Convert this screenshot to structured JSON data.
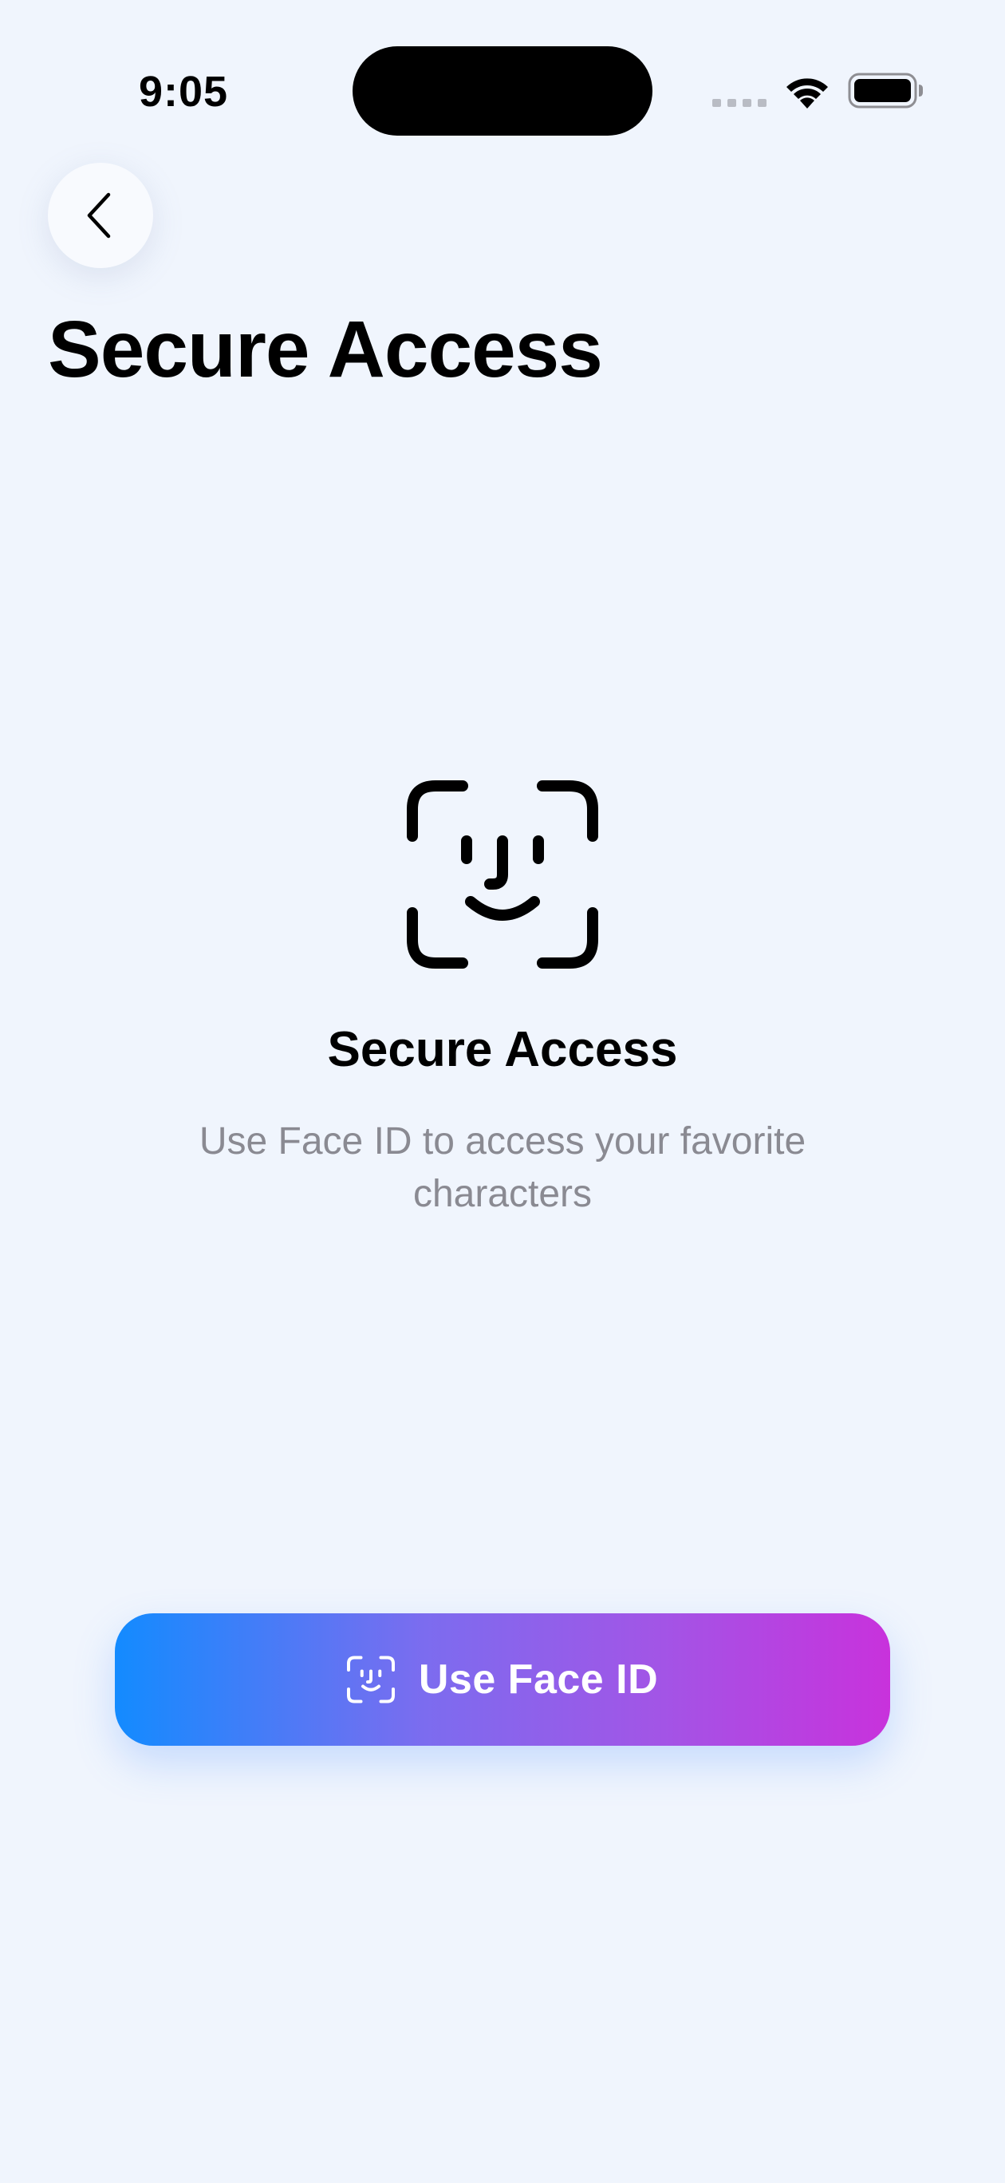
{
  "status_bar": {
    "time": "9:05",
    "icons": [
      "cellular-signal-icon",
      "wifi-icon",
      "battery-icon"
    ]
  },
  "nav": {
    "back_icon": "chevron-left-icon"
  },
  "header": {
    "title": "Secure Access"
  },
  "main": {
    "hero_icon": "face-id-icon",
    "heading": "Secure Access",
    "description": "Use Face ID to access your favorite characters"
  },
  "action": {
    "button_label": "Use Face ID",
    "button_icon": "face-id-icon",
    "gradient_start": "#138BFF",
    "gradient_end": "#C832DC"
  },
  "colors": {
    "background": "#F0F5FD",
    "text_primary": "#000000",
    "text_secondary": "#8A8A92"
  }
}
